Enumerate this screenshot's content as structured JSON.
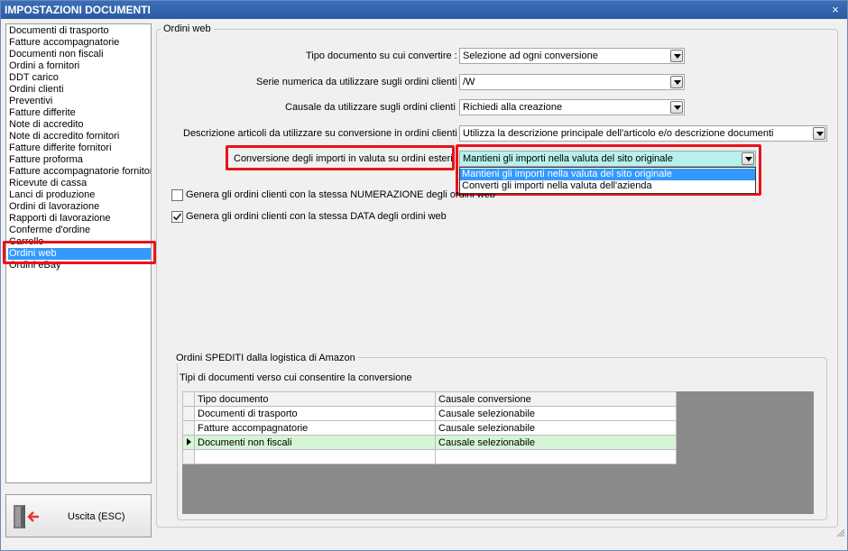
{
  "window": {
    "title": "IMPOSTAZIONI DOCUMENTI",
    "close_glyph": "×"
  },
  "sidebar": {
    "items": [
      {
        "label": "Documenti di trasporto"
      },
      {
        "label": "Fatture accompagnatorie"
      },
      {
        "label": "Documenti non fiscali"
      },
      {
        "label": "Ordini a fornitori"
      },
      {
        "label": "DDT carico"
      },
      {
        "label": "Ordini clienti"
      },
      {
        "label": "Preventivi"
      },
      {
        "label": "Fatture differite"
      },
      {
        "label": "Note di accredito"
      },
      {
        "label": "Note di accredito fornitori"
      },
      {
        "label": "Fatture differite fornitori"
      },
      {
        "label": "Fatture proforma"
      },
      {
        "label": "Fatture accompagnatorie fornitori"
      },
      {
        "label": "Ricevute di cassa"
      },
      {
        "label": "Lanci di produzione"
      },
      {
        "label": "Ordini di lavorazione"
      },
      {
        "label": "Rapporti di lavorazione"
      },
      {
        "label": "Conferme d'ordine"
      },
      {
        "label": "Carrello"
      },
      {
        "label": "Ordini web",
        "selected": true
      },
      {
        "label": "Ordini eBay"
      }
    ]
  },
  "exit_button": {
    "label": "Uscita (ESC)",
    "icon": "exit-door-icon"
  },
  "main": {
    "group_title": "Ordini web",
    "fields": {
      "tipo_documento": {
        "label": "Tipo documento su cui convertire :",
        "value": "Selezione ad ogni conversione"
      },
      "serie_numerica": {
        "label": "Serie numerica da utilizzare sugli ordini clienti :",
        "value": "/W"
      },
      "causale": {
        "label": "Causale da utilizzare sugli ordini clienti :",
        "value": "Richiedi alla creazione"
      },
      "descrizione_articoli": {
        "label": "Descrizione articoli da utilizzare su conversione in ordini clienti :",
        "value": "Utilizza la descrizione principale dell'articolo e/o descrizione documenti"
      },
      "conversione_importi": {
        "label": "Conversione degli importi in valuta su ordini esteri :",
        "value": "Mantieni gli importi nella valuta del sito originale",
        "options": [
          "Mantieni gli importi nella valuta del sito originale",
          "Converti gli importi nella valuta dell'azienda"
        ]
      }
    },
    "checkboxes": {
      "numerazione": {
        "label": "Genera gli ordini clienti con la stessa NUMERAZIONE degli ordini web",
        "checked": false
      },
      "data": {
        "label": "Genera gli ordini clienti con la stessa DATA degli ordini web",
        "checked": true
      }
    }
  },
  "amazon": {
    "group_title": "Ordini SPEDITI dalla logistica di Amazon",
    "subtitle": "Tipi di documenti verso cui consentire la conversione",
    "grid": {
      "columns": [
        "Tipo documento",
        "Causale conversione"
      ],
      "rows": [
        [
          "Documenti di trasporto",
          "Causale selezionabile"
        ],
        [
          "Fatture accompagnatorie",
          "Causale selezionabile"
        ],
        [
          "Documenti non fiscali",
          "Causale selezionabile"
        ]
      ]
    }
  },
  "colors": {
    "title_bar": "#2c5aa0",
    "selection": "#3399ff",
    "highlight_frame": "#e8131b",
    "combo_highlight": "#b7f0ec",
    "current_row": "#d6f5d6"
  }
}
